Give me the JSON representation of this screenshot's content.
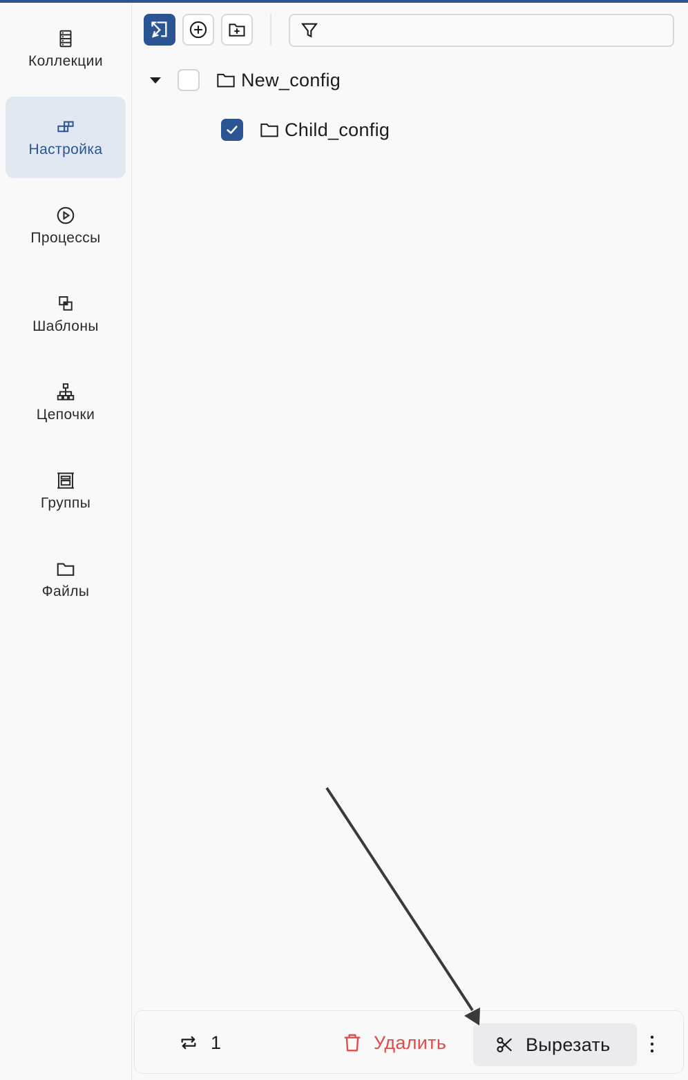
{
  "sidebar": {
    "items": [
      {
        "label": "Коллекции",
        "icon": "server-list-icon",
        "active": false
      },
      {
        "label": "Настройка",
        "icon": "blocks-icon",
        "active": true
      },
      {
        "label": "Процессы",
        "icon": "play-circle-icon",
        "active": false
      },
      {
        "label": "Шаблоны",
        "icon": "copy-squares-icon",
        "active": false
      },
      {
        "label": "Цепочки",
        "icon": "hierarchy-icon",
        "active": false
      },
      {
        "label": "Группы",
        "icon": "group-frame-icon",
        "active": false
      },
      {
        "label": "Файлы",
        "icon": "folder-icon",
        "active": false
      }
    ]
  },
  "toolbar": {
    "buttons": [
      "select-mode-icon",
      "add-circle-icon",
      "add-folder-icon"
    ],
    "filter_icon": "filter-icon",
    "filter_value": ""
  },
  "tree": {
    "nodes": [
      {
        "label": "New_config",
        "expanded": true,
        "checked": false,
        "level": 0
      },
      {
        "label": "Child_config",
        "checked": true,
        "level": 1
      }
    ]
  },
  "bottom_bar": {
    "count_icon": "repeat-icon",
    "selected_count": "1",
    "delete_label": "Удалить",
    "cut_label": "Вырезать",
    "more_icon": "more-vertical-icon"
  },
  "colors": {
    "accent": "#2b5493",
    "active_bg": "#e1e8f1",
    "danger": "#e24b4b",
    "arrow": "#3a3a3a"
  }
}
